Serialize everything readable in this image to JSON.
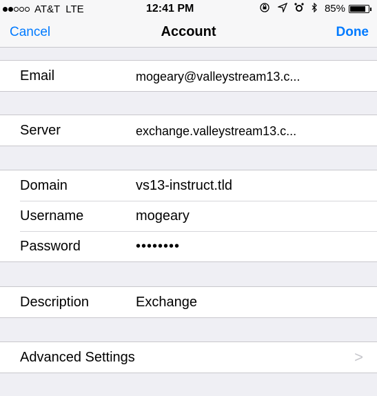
{
  "status_bar": {
    "carrier": "AT&T",
    "network": "LTE",
    "time": "12:41 PM",
    "battery": "85%",
    "battery_level": 0.85,
    "icons": [
      "signal-dots-icon",
      "rotation-lock-icon",
      "location-arrow-icon",
      "alarm-icon",
      "bluetooth-icon",
      "battery-icon"
    ]
  },
  "nav": {
    "cancel_label": "Cancel",
    "title": "Account",
    "done_label": "Done",
    "accent_color": "#007aff"
  },
  "sections": {
    "email": {
      "label": "Email",
      "value": "mogeary@valleystream13.c..."
    },
    "server": {
      "label": "Server",
      "value": "exchange.valleystream13.c..."
    },
    "domain": {
      "label": "Domain",
      "value": "vs13-instruct.tld"
    },
    "username": {
      "label": "Username",
      "value": "mogeary"
    },
    "password": {
      "label": "Password",
      "value": "••••••••"
    },
    "description": {
      "label": "Description",
      "value": "Exchange"
    },
    "advanced": {
      "label": "Advanced Settings",
      "chevron": ">"
    }
  }
}
